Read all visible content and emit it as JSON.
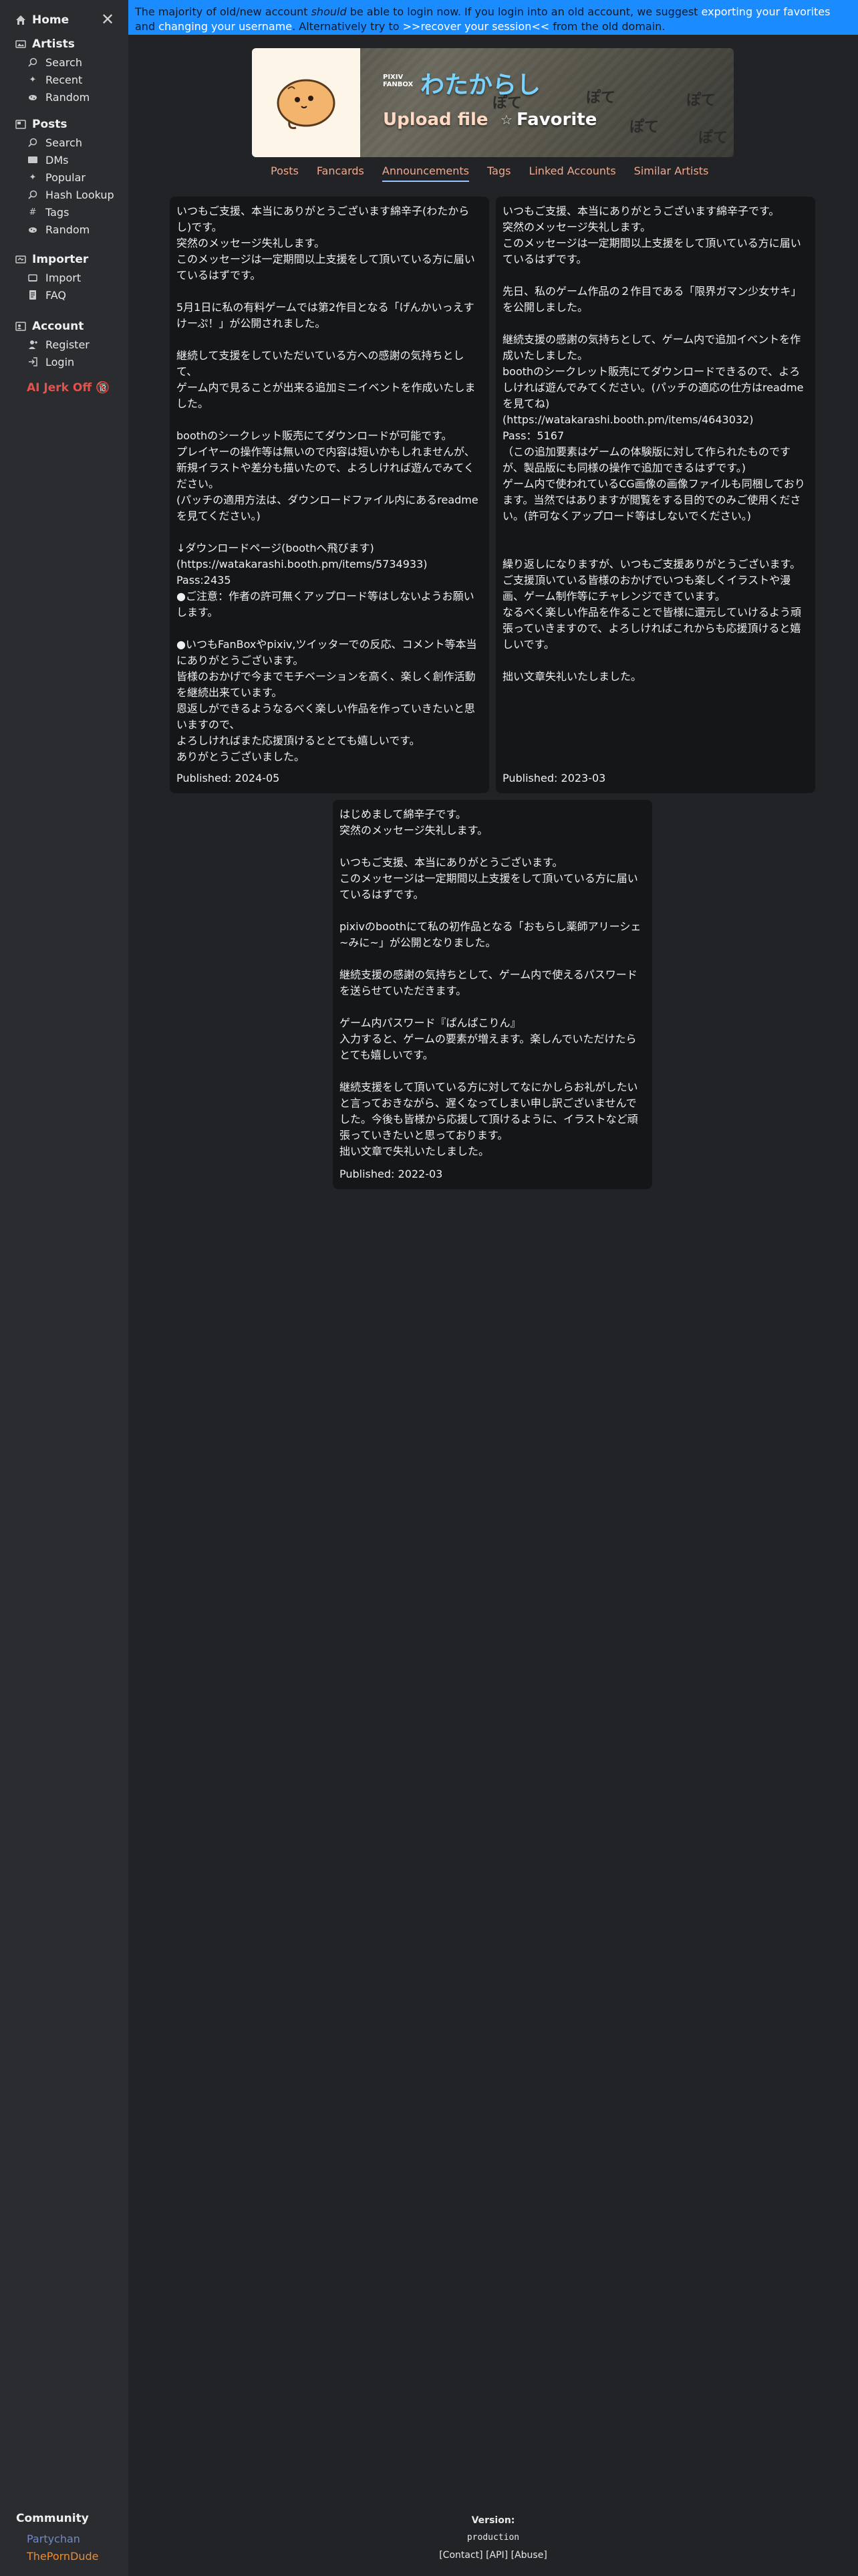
{
  "sidebar": {
    "home": "Home",
    "artists": {
      "title": "Artists",
      "items": [
        "Search",
        "Recent",
        "Random"
      ]
    },
    "posts": {
      "title": "Posts",
      "items": [
        "Search",
        "DMs",
        "Popular",
        "Hash Lookup",
        "Tags",
        "Random"
      ]
    },
    "importer": {
      "title": "Importer",
      "items": [
        "Import",
        "FAQ"
      ]
    },
    "account": {
      "title": "Account",
      "items": [
        "Register",
        "Login"
      ]
    },
    "jerk_off": "AI Jerk Off 🔞",
    "community": {
      "title": "Community",
      "links": [
        "Partychan",
        "ThePornDude"
      ]
    }
  },
  "banner": {
    "text1": "The majority of old/new account ",
    "em": "should",
    "text2": " be able to login now. If you login into an old account, we suggest ",
    "link1": "exporting your favorites",
    "text3": " and ",
    "link2": "changing your username",
    "text4": ". Alternatively try to ",
    "link3": ">>recover your session<<",
    "text5": " from the old domain."
  },
  "header": {
    "service_line1": "PIXIV",
    "service_line2": "FANBOX",
    "artist_name": "わたからし",
    "upload": "Upload file",
    "favorite": "Favorite",
    "doodle": "ぽて"
  },
  "tabs": [
    "Posts",
    "Fancards",
    "Announcements",
    "Tags",
    "Linked Accounts",
    "Similar Artists"
  ],
  "announcements": [
    {
      "body": "いつもご支援、本当にありがとうございます綿辛子(わたからし)です。\n突然のメッセージ失礼します。\nこのメッセージは一定期間以上支援をして頂いている方に届いているはずです。\n\n5月1日に私の有料ゲームでは第2作目となる「げんかいっえすけーぷ！」が公開されました。\n\n継続して支援をしていただいている方への感謝の気持ちとして、\nゲーム内で見ることが出来る追加ミニイベントを作成いたしました。\n\nboothのシークレット販売にてダウンロードが可能です。\nプレイヤーの操作等は無いので内容は短いかもしれませんが、新規イラストや差分も描いたので、よろしければ遊んでみてください。\n(パッチの適用方法は、ダウンロードファイル内にあるreadmeを見てください。)\n\n↓ダウンロードページ(boothへ飛びます)\n(https://watakarashi.booth.pm/items/5734933)\nPass:2435\n●ご注意：作者の許可無くアップロード等はしないようお願いします。\n\n●いつもFanBoxやpixiv,ツイッターでの反応、コメント等本当にありがとうございます。\n皆様のおかげで今までモチベーションを高く、楽しく創作活動を継続出来ています。\n恩返しができるようなるべく楽しい作品を作っていきたいと思いますので、\nよろしければまた応援頂けるととても嬉しいです。\nありがとうございました。",
      "published": "Published: 2024-05"
    },
    {
      "body": "いつもご支援、本当にありがとうございます綿辛子です。\n突然のメッセージ失礼します。\nこのメッセージは一定期間以上支援をして頂いている方に届いているはずです。\n\n先日、私のゲーム作品の２作目である「限界ガマン少女サキ」を公開しました。\n\n継続支援の感謝の気持ちとして、ゲーム内で追加イベントを作成いたしました。\nboothのシークレット販売にてダウンロードできるので、よろしければ遊んでみてください。(パッチの適応の仕方はreadmeを見てね)\n(https://watakarashi.booth.pm/items/4643032)\nPass：5167\n（この追加要素はゲームの体験版に対して作られたものですが、製品版にも同様の操作で追加できるはずです。)\nゲーム内で使われているCG画像の画像ファイルも同梱しております。当然ではありますが閲覧をする目的でのみご使用ください。(許可なくアップロード等はしないでください。)\n\n\n繰り返しになりますが、いつもご支援ありがとうございます。\nご支援頂いている皆様のおかげでいつも楽しくイラストや漫画、ゲーム制作等にチャレンジできています。\nなるべく楽しい作品を作ることで皆様に還元していけるよう頑張っていきますので、よろしければこれからも応援頂けると嬉しいです。\n\n拙い文章失礼いたしました。",
      "published": "Published: 2023-03"
    },
    {
      "body": "はじめまして綿辛子です。\n突然のメッセージ失礼します。\n\nいつもご支援、本当にありがとうございます。\nこのメッセージは一定期間以上支援をして頂いている方に届いているはずです。\n\npixivのboothにて私の初作品となる「おもらし薬師アリーシェ~みに~」が公開となりました。\n\n継続支援の感謝の気持ちとして、ゲーム内で使えるパスワードを送らせていただきます。\n\nゲーム内パスワード『ぱんぱこりん』\n入力すると、ゲームの要素が増えます。楽しんでいただけたらとても嬉しいです。\n\n継続支援をして頂いている方に対してなにかしらお礼がしたいと言っておきながら、遅くなってしまい申し訳ございませんでした。今後も皆様から応援して頂けるように、イラストなど頑張っていきたいと思っております。\n拙い文章で失礼いたしました。",
      "published": "Published: 2022-03"
    }
  ],
  "footer": {
    "version_label": "Version:",
    "version": "production",
    "contact": "[Contact]",
    "api": "[API]",
    "abuse": "[Abuse]"
  },
  "colors": {
    "banner": "#1b8cff",
    "tab": "#f1a98d",
    "artist_name": "#7ad3ff",
    "jerk": "#e7514b",
    "partychan": "#6f88c7",
    "porndude": "#f28a2a"
  }
}
